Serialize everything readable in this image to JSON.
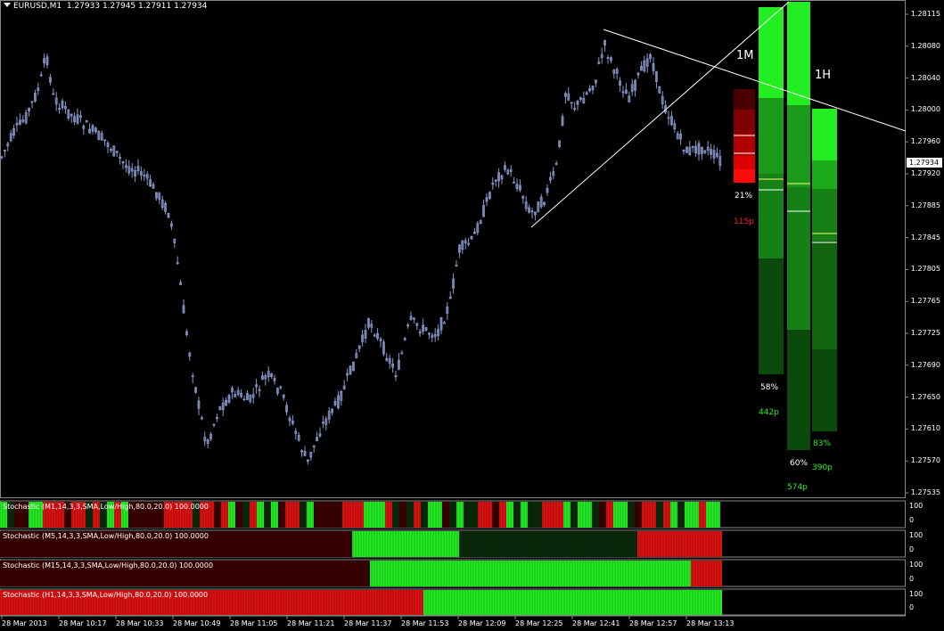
{
  "header": {
    "symbol_label": "EURUSD,M1",
    "quotes": "1.27933 1.27945 1.27911 1.27934"
  },
  "current_price": "1.27934",
  "price_labels": [
    "1.28115",
    "1.28080",
    "1.28040",
    "1.28000",
    "1.27960",
    "1.27920",
    "1.27885",
    "1.27845",
    "1.27805",
    "1.27765",
    "1.27725",
    "1.27690",
    "1.27650",
    "1.27610",
    "1.27570",
    "1.27535"
  ],
  "time_labels": [
    "28 Mar 2013",
    "28 Mar 10:17",
    "28 Mar 10:33",
    "28 Mar 10:49",
    "28 Mar 11:05",
    "28 Mar 11:21",
    "28 Mar 11:37",
    "28 Mar 11:53",
    "28 Mar 12:09",
    "28 Mar 12:25",
    "28 Mar 12:41",
    "28 Mar 12:57",
    "28 Mar 13:13"
  ],
  "overlay": {
    "bar_a": {
      "pct": "21%",
      "pips": "115p"
    },
    "bar_1m": {
      "tf": "1M",
      "pct": "58%",
      "pips": "442p"
    },
    "bar_1h": {
      "tf": "1H",
      "pct": "60%",
      "pips": "574p"
    },
    "bar_c": {
      "pct": "83%",
      "pips": "390p"
    }
  },
  "subwindows": [
    {
      "label": "Stochastic (M1,14,3,3,SMA,Low/High,80.0,20.0) 100.0000",
      "scale_top": "100",
      "scale_bottom": "0"
    },
    {
      "label": "Stochastic (M5,14,3,3,SMA,Low/High,80.0,20.0) 100.0000",
      "scale_top": "100",
      "scale_bottom": "0"
    },
    {
      "label": "Stochastic (M15,14,3,3,SMA,Low/High,80.0,20.0) 100.0000",
      "scale_top": "100",
      "scale_bottom": "0"
    },
    {
      "label": "Stochastic (H1,14,3,3,SMA,Low/High,80.0,20.0) 100.0000",
      "scale_top": "100",
      "scale_bottom": "0"
    }
  ],
  "colors": {
    "bg": "#000000",
    "candle": "#8899cc",
    "bright_green": "#22ee22",
    "dark_green": "#0a4a0a",
    "red": "#dd1111",
    "dark_red": "#3a0000",
    "line": "#ffffff"
  }
}
